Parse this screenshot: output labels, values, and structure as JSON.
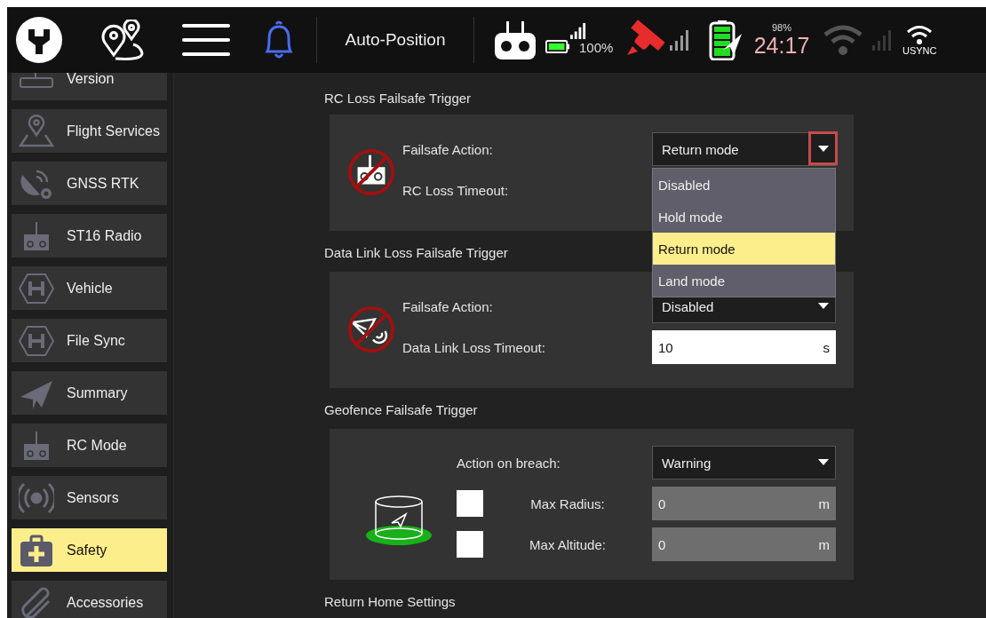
{
  "top_bar": {
    "mode": "Auto-Position",
    "rc_battery": "100%",
    "battery_percent": "98%",
    "flight_time": "24:17",
    "wifi_label": "USYNC"
  },
  "sidebar": {
    "items": [
      {
        "label": "Version",
        "kind": "device",
        "selected": false
      },
      {
        "label": "Flight Services",
        "kind": "map",
        "selected": false
      },
      {
        "label": "GNSS RTK",
        "kind": "gnss",
        "selected": false
      },
      {
        "label": "ST16 Radio",
        "kind": "radio",
        "selected": false
      },
      {
        "label": "Vehicle",
        "kind": "hex",
        "selected": false
      },
      {
        "label": "File Sync",
        "kind": "hex",
        "selected": false
      },
      {
        "label": "Summary",
        "kind": "plane",
        "selected": false
      },
      {
        "label": "RC Mode",
        "kind": "radio",
        "selected": false
      },
      {
        "label": "Sensors",
        "kind": "sensors",
        "selected": false
      },
      {
        "label": "Safety",
        "kind": "kit",
        "selected": true
      },
      {
        "label": "Accessories",
        "kind": "clip",
        "selected": false
      }
    ]
  },
  "sections": [
    {
      "kind": "failsafe",
      "title": "RC Loss Failsafe Trigger",
      "action_label": "Failsafe Action:",
      "action_value": "Return mode",
      "action_open": true,
      "options": [
        {
          "label": "Disabled",
          "selected": false
        },
        {
          "label": "Hold mode",
          "selected": false
        },
        {
          "label": "Return mode",
          "selected": true
        },
        {
          "label": "Land mode",
          "selected": false
        }
      ],
      "timeout_label": "RC Loss Timeout:"
    },
    {
      "kind": "failsafe",
      "title": "Data Link Loss Failsafe Trigger",
      "action_label": "Failsafe Action:",
      "action_value": "Disabled",
      "action_open": false,
      "timeout_label": "Data Link Loss Timeout:",
      "timeout_value": "10",
      "timeout_unit": "s"
    },
    {
      "kind": "geofence",
      "title": "Geofence Failsafe Trigger",
      "action_label": "Action on breach:",
      "action_value": "Warning",
      "limits": [
        {
          "label": "Max Radius:",
          "checked": false,
          "value": "0",
          "unit": "m"
        },
        {
          "label": "Max Altitude:",
          "checked": false,
          "value": "0",
          "unit": "m"
        }
      ]
    },
    {
      "kind": "title",
      "title": "Return Home Settings"
    }
  ]
}
